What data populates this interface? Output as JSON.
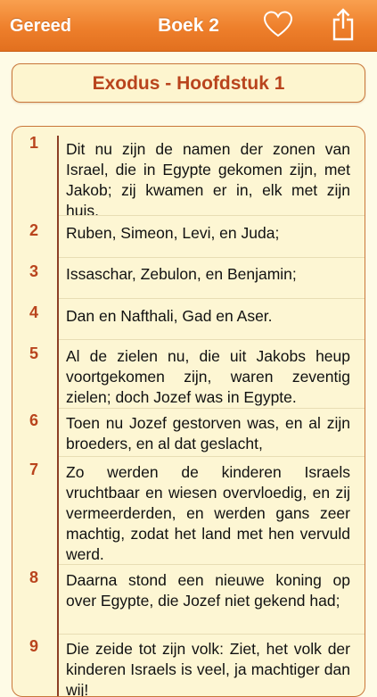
{
  "navbar": {
    "done_label": "Gereed",
    "title": "Boek 2",
    "favorite_icon": "heart-outline-icon",
    "share_icon": "share-icon"
  },
  "chapter": {
    "title": "Exodus - Hoofdstuk 1"
  },
  "verses": [
    {
      "number": "1",
      "text": "Dit nu zijn de namen der zonen van Israel, die in Egypte gekomen zijn, met Jakob; zij kwamen er in, elk met zijn huis."
    },
    {
      "number": "2",
      "text": "Ruben, Simeon, Levi, en Juda;"
    },
    {
      "number": "3",
      "text": "Issaschar, Zebulon, en Benjamin;"
    },
    {
      "number": "4",
      "text": "Dan en Nafthali, Gad en Aser."
    },
    {
      "number": "5",
      "text": "Al de zielen nu, die uit Jakobs heup voortgekomen zijn, waren zeventig zielen; doch Jozef was in Egypte."
    },
    {
      "number": "6",
      "text": "Toen nu Jozef gestorven was, en al zijn broeders, en al dat geslacht,"
    },
    {
      "number": "7",
      "text": "Zo werden de kinderen Israels vruchtbaar en wiesen overvloedig, en zij vermeerderden, en werden gans zeer machtig, zodat het land met hen vervuld werd."
    },
    {
      "number": "8",
      "text": "Daarna stond een nieuwe koning op over Egypte, die Jozef niet gekend had;"
    },
    {
      "number": "9",
      "text": "Die zeide tot zijn volk: Ziet, het volk der kinderen Israels is veel, ja machtiger dan wij!"
    }
  ],
  "colors": {
    "accent": "#ee7f2b",
    "verse_number": "#b9441d",
    "border": "#c9763a",
    "background": "#fefbe6"
  }
}
